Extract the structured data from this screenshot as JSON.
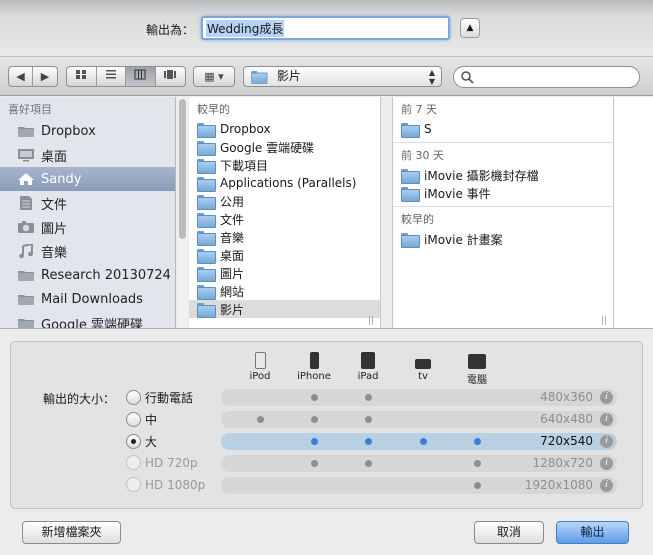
{
  "header": {
    "save_as_label": "輸出為：",
    "filename": "Wedding成長"
  },
  "toolbar": {
    "location": "影片",
    "search_placeholder": ""
  },
  "sidebar": {
    "heading": "喜好項目",
    "items": [
      {
        "label": "Dropbox",
        "icon": "folder-icon"
      },
      {
        "label": "桌面",
        "icon": "desktop-icon"
      },
      {
        "label": "Sandy",
        "icon": "home-icon"
      },
      {
        "label": "文件",
        "icon": "documents-icon"
      },
      {
        "label": "圖片",
        "icon": "camera-icon"
      },
      {
        "label": "音樂",
        "icon": "music-icon"
      },
      {
        "label": "Research 20130724",
        "icon": "folder-icon"
      },
      {
        "label": "Mail Downloads",
        "icon": "folder-icon"
      },
      {
        "label": "Google 雲端硬碟",
        "icon": "folder-icon"
      }
    ]
  },
  "column1": {
    "heading": "較早的",
    "items": [
      "Dropbox",
      "Google 雲端硬碟",
      "下載項目",
      "Applications (Parallels)",
      "公用",
      "文件",
      "音樂",
      "桌面",
      "圖片",
      "網站",
      "影片"
    ]
  },
  "column2": {
    "groups": [
      {
        "heading": "前 7 天",
        "items": [
          "S"
        ]
      },
      {
        "heading": "前 30 天",
        "items": [
          "iMovie 攝影機封存檔",
          "iMovie 事件"
        ]
      },
      {
        "heading": "較早的",
        "items": [
          "iMovie 計畫案"
        ]
      }
    ]
  },
  "export": {
    "size_label": "輸出的大小：",
    "devices": [
      "iPod",
      "iPhone",
      "iPad",
      "tv",
      "電腦"
    ],
    "options": [
      {
        "label": "行動電話",
        "resolution": "480x360"
      },
      {
        "label": "中",
        "resolution": "640x480"
      },
      {
        "label": "大",
        "resolution": "720x540"
      },
      {
        "label": "HD 720p",
        "resolution": "1280x720"
      },
      {
        "label": "HD 1080p",
        "resolution": "1920x1080"
      }
    ]
  },
  "buttons": {
    "new_folder": "新增檔案夾",
    "cancel": "取消",
    "save": "輸出"
  }
}
